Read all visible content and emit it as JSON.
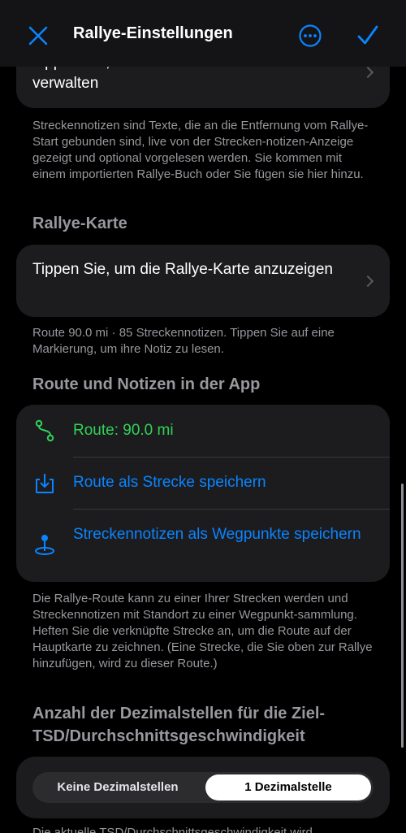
{
  "nav": {
    "title": "Rallye-Einstellungen",
    "close_icon": "close-icon",
    "more_icon": "ellipsis-circle-icon",
    "done_icon": "checkmark-icon",
    "accent": "#0a84ff"
  },
  "notes_card": {
    "label_partial": "Tippen Sie, um Streckennotizen zu",
    "label_line2": "verwalten"
  },
  "notes_footnote": "Streckennotizen sind Texte, die an die Entfernung vom Rallye-Start gebunden sind, live von der Strecken-notizen-Anzeige gezeigt und optional vorgelesen werden. Sie kommen mit einem importierten Rallye-Buch oder Sie fügen sie hier hinzu.",
  "map_section": {
    "title": "Rallye-Karte",
    "row_label": "Tippen Sie, um die Rallye-Karte anzuzeigen",
    "footnote": "Route 90.0 mi · 85 Streckennotizen. Tippen Sie auf eine Markierung, um ihre Notiz zu lesen."
  },
  "app_section": {
    "title": "Route und Notizen in der App",
    "rows": [
      {
        "label": "Route: 90.0 mi",
        "icon": "route-icon",
        "color": "#30d158"
      },
      {
        "label": "Route als Strecke speichern",
        "icon": "save-download-icon",
        "color": "#0a84ff"
      },
      {
        "label": "Streckennotizen als Wegpunkte speichern",
        "icon": "map-pin-icon",
        "color": "#0a84ff"
      }
    ],
    "footnote": "Die Rallye-Route kann zu einer Ihrer Strecken werden und Streckennotizen mit Standort zu einer Wegpunkt-sammlung. Heften Sie die verknüpfte Strecke an, um die Route auf der Hauptkarte zu zeichnen. (Eine Strecke, die Sie oben zur Rallye hinzufügen, wird zu dieser Route.)"
  },
  "decimal_section": {
    "title": "Anzahl der Dezimalstellen für die Ziel-TSD/Durchschnittsgeschwindigkeit",
    "options": [
      "Keine Dezimalstellen",
      "1 Dezimalstelle"
    ],
    "selected": "1 Dezimalstelle",
    "footnote_partial": "Die aktuelle TSD/Durchschnittsgeschwindigkeit wird"
  }
}
